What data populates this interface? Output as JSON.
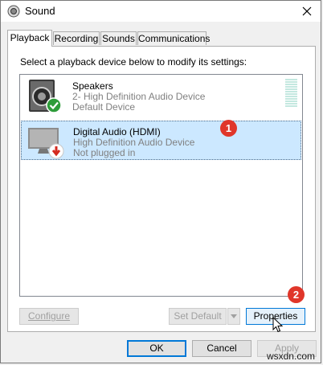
{
  "window": {
    "title": "Sound",
    "title_icon": "speaker-icon"
  },
  "tabs": [
    {
      "label": "Playback",
      "active": true
    },
    {
      "label": "Recording",
      "active": false
    },
    {
      "label": "Sounds",
      "active": false
    },
    {
      "label": "Communications",
      "active": false
    }
  ],
  "playback": {
    "instruction": "Select a playback device below to modify its settings:",
    "devices": [
      {
        "name": "Speakers",
        "line2": "2- High Definition Audio Device",
        "line3": "Default Device",
        "icon": "speakers-icon",
        "status_icon": "default-check-icon",
        "selected": false
      },
      {
        "name": "Digital Audio (HDMI)",
        "line2": "High Definition Audio Device",
        "line3": "Not plugged in",
        "icon": "monitor-icon",
        "status_icon": "unplugged-arrow-icon",
        "selected": true
      }
    ],
    "configure_label": "Configure",
    "set_default_label": "Set Default",
    "properties_label": "Properties"
  },
  "footer": {
    "ok_label": "OK",
    "cancel_label": "Cancel",
    "apply_label": "Apply"
  },
  "annotations": {
    "badge1": "1",
    "badge2": "2"
  },
  "watermark": "wsxdn.com",
  "colors": {
    "selection": "#cce8ff",
    "badge": "#e0362a",
    "check": "#2e9c3a",
    "accent": "#0078d7"
  }
}
